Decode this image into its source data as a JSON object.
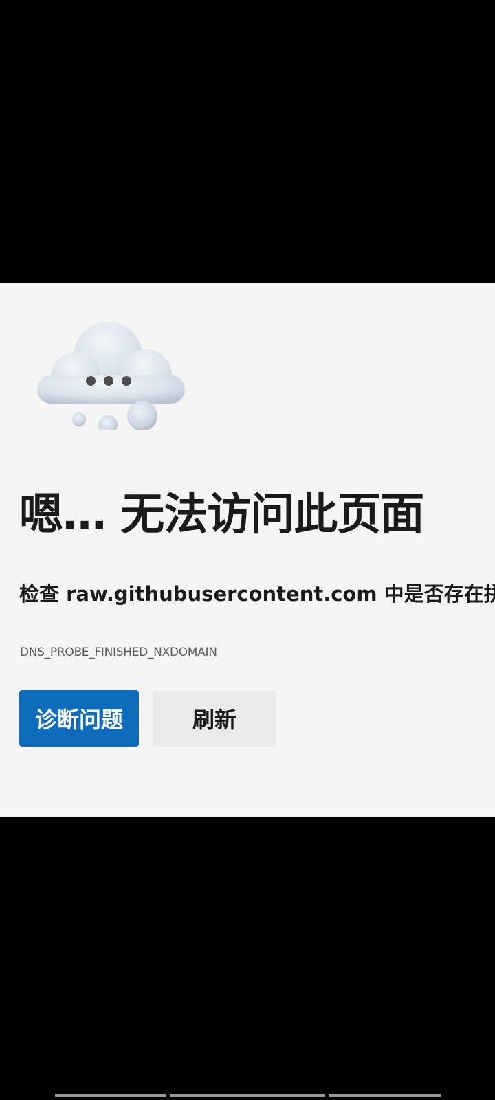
{
  "error_page": {
    "headline": "嗯… 无法访问此页面",
    "subline": "检查 raw.githubusercontent.com 中是否存在拼",
    "error_code": "DNS_PROBE_FINISHED_NXDOMAIN",
    "buttons": {
      "diagnose_label": "诊断问题",
      "refresh_label": "刷新"
    },
    "illustration": "cloud-icon"
  },
  "colors": {
    "panel_background": "#f5f5f5",
    "primary_button": "#0f6cbd",
    "secondary_button": "#ebebeb",
    "text": "#1a1a1a",
    "error_code_text": "#5c5c5c"
  }
}
